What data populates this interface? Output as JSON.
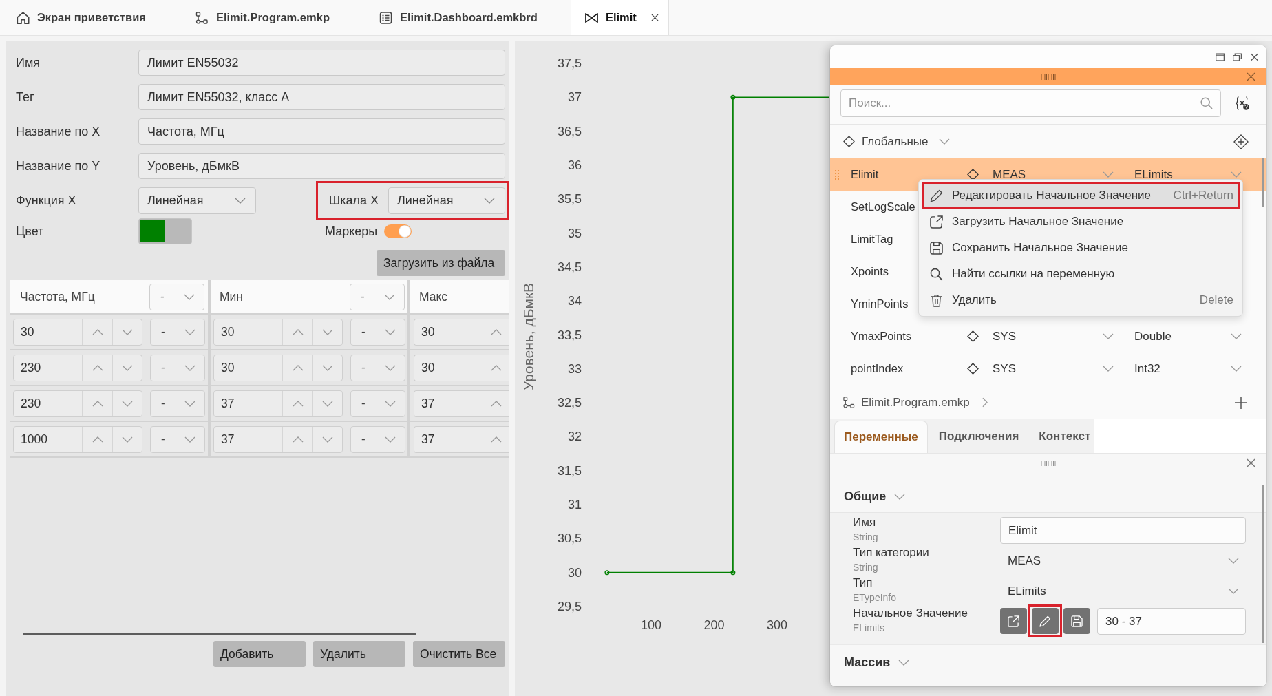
{
  "tabs": [
    {
      "kind": "home",
      "label": "Экран приветствия",
      "selected": false
    },
    {
      "kind": "program",
      "label": "Elimit.Program.emkp",
      "selected": false
    },
    {
      "kind": "dashboard",
      "label": "Elimit.Dashboard.emkbrd",
      "selected": false
    },
    {
      "kind": "chart",
      "label": "Elimit",
      "selected": true
    }
  ],
  "form": {
    "fields": [
      {
        "label": "Имя",
        "value": "Лимит EN55032"
      },
      {
        "label": "Тег",
        "value": "Лимит EN55032, класс A"
      },
      {
        "label": "Название по X",
        "value": "Частота, МГц"
      },
      {
        "label": "Название по Y",
        "value": "Уровень, дБмкВ"
      }
    ],
    "function_x": {
      "label": "Функция X",
      "value": "Линейная"
    },
    "scale_x": {
      "label": "Шкала X",
      "value": "Линейная",
      "highlighted": true
    },
    "color": {
      "label": "Цвет",
      "color": "#008000"
    },
    "markers": {
      "label": "Маркеры",
      "on": true
    },
    "load_button": "Загрузить из файла"
  },
  "table": {
    "columns": [
      {
        "label": "Частота, МГц",
        "unit": "-"
      },
      {
        "label": "Мин",
        "unit": "-"
      },
      {
        "label": "Макс"
      }
    ],
    "rows": [
      {
        "cells": [
          {
            "value": "30",
            "unit": "-"
          },
          {
            "value": "30",
            "unit": "-"
          },
          {
            "value": "30"
          }
        ]
      },
      {
        "cells": [
          {
            "value": "230",
            "unit": "-"
          },
          {
            "value": "30",
            "unit": "-"
          },
          {
            "value": "30"
          }
        ]
      },
      {
        "cells": [
          {
            "value": "230",
            "unit": "-"
          },
          {
            "value": "37",
            "unit": "-"
          },
          {
            "value": "37"
          }
        ]
      },
      {
        "cells": [
          {
            "value": "1000",
            "unit": "-"
          },
          {
            "value": "37",
            "unit": "-"
          },
          {
            "value": "37"
          }
        ]
      }
    ],
    "buttons": [
      "Добавить",
      "Удалить",
      "Очистить Все"
    ]
  },
  "chart": {
    "chart_data": {
      "type": "line",
      "ylabel": "Уровень, дБмкВ",
      "x": [
        30,
        230,
        230,
        382
      ],
      "series": [
        {
          "color": "#008000",
          "values": [
            30,
            30,
            37,
            37
          ]
        }
      ],
      "xlim": [
        17,
        382
      ],
      "ylim": [
        29.5,
        37.5
      ],
      "xticks": [
        100,
        200,
        300
      ],
      "yticks": [
        {
          "value": 37.5,
          "label": "37,5"
        },
        37,
        {
          "value": 36.5,
          "label": "36,5"
        },
        36,
        {
          "value": 35.5,
          "label": "35,5"
        },
        35,
        {
          "value": 34.5,
          "label": "34,5"
        },
        34,
        {
          "value": 33.5,
          "label": "33,5"
        },
        33,
        {
          "value": 32.5,
          "label": "32,5"
        },
        32,
        {
          "value": 31.5,
          "label": "31,5"
        },
        31,
        {
          "value": 30.5,
          "label": "30,5"
        },
        30,
        {
          "value": 29.5,
          "label": "29,5"
        }
      ]
    }
  },
  "variables_panel": {
    "search": {
      "placeholder": "Поиск..."
    },
    "scope": {
      "label": "Глобальные"
    },
    "variables": [
      {
        "name": "Elimit",
        "category": "MEAS",
        "type": "ELimits",
        "selected": true
      },
      {
        "name": "SetLogScale",
        "selected": false
      },
      {
        "name": "LimitTag",
        "selected": false
      },
      {
        "name": "Xpoints",
        "selected": false
      },
      {
        "name": "YminPoints",
        "selected": false
      },
      {
        "name": "YmaxPoints",
        "category": "SYS",
        "type": "Double",
        "selected": false
      },
      {
        "name": "pointIndex",
        "category": "SYS",
        "type": "Int32",
        "selected": false
      }
    ],
    "context_menu": [
      {
        "kind": "edit",
        "label": "Редактировать Начальное Значение",
        "shortcut": "Ctrl+Return",
        "hovered": true,
        "highlighted": true
      },
      {
        "kind": "load",
        "label": "Загрузить Начальное Значение",
        "hovered": false,
        "highlighted": false
      },
      {
        "kind": "save",
        "label": "Сохранить Начальное Значение",
        "hovered": false,
        "highlighted": false
      },
      {
        "kind": "find",
        "label": "Найти ссылки на переменную",
        "hovered": false,
        "highlighted": false
      },
      {
        "kind": "delete",
        "label": "Удалить",
        "shortcut": "Delete",
        "hovered": false,
        "highlighted": false
      }
    ],
    "breadcrumb": {
      "label": "Elimit.Program.emkp"
    },
    "tabs": [
      {
        "label": "Переменные",
        "selected": true
      },
      {
        "label": "Подключения",
        "selected": false
      },
      {
        "label": "Контекст",
        "selected": false
      }
    ],
    "sections": [
      {
        "title": "Общие",
        "properties": [
          {
            "kind": "text",
            "label": "Имя",
            "type": "String",
            "value": "Elimit"
          },
          {
            "kind": "dropdown",
            "label": "Тип категории",
            "type": "String",
            "value": "MEAS"
          },
          {
            "kind": "dropdown",
            "label": "Тип",
            "type": "ETypeInfo",
            "value": "ELimits"
          },
          {
            "kind": "initial",
            "label": "Начальное Значение",
            "type": "ELimits",
            "value": "30 - 37",
            "actions": [
              {
                "kind": "open",
                "highlighted": false
              },
              {
                "kind": "edit",
                "highlighted": true
              },
              {
                "kind": "save",
                "highlighted": false
              }
            ]
          }
        ]
      },
      {
        "title": "Массив"
      }
    ]
  }
}
